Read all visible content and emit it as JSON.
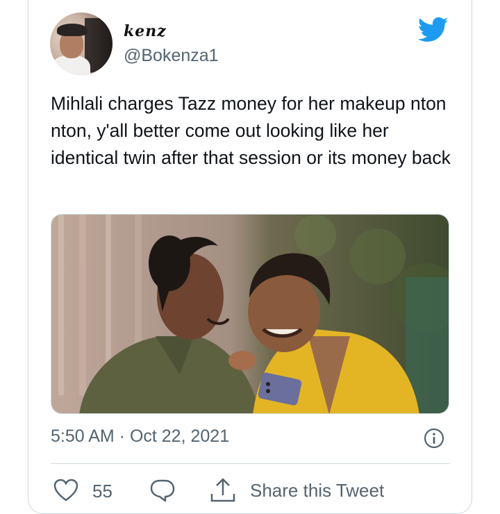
{
  "user": {
    "display_name": "kenz",
    "handle": "@Bokenza1",
    "avatar_icon": "profile-photo"
  },
  "brand": {
    "logo_icon": "twitter-bird-icon",
    "color": "#1d9bf0"
  },
  "tweet": {
    "text": "Mihlali charges Tazz money for her makeup nton nton, y'all better come out looking like her identical twin after that session or its money back",
    "media_description_icon": "photo",
    "timestamp": "5:50 AM · Oct 22, 2021"
  },
  "actions": {
    "like_count": "55",
    "share_label": "Share this Tweet"
  },
  "colors": {
    "text": "#0f1419",
    "muted": "#536471",
    "border": "#cfd9de"
  }
}
